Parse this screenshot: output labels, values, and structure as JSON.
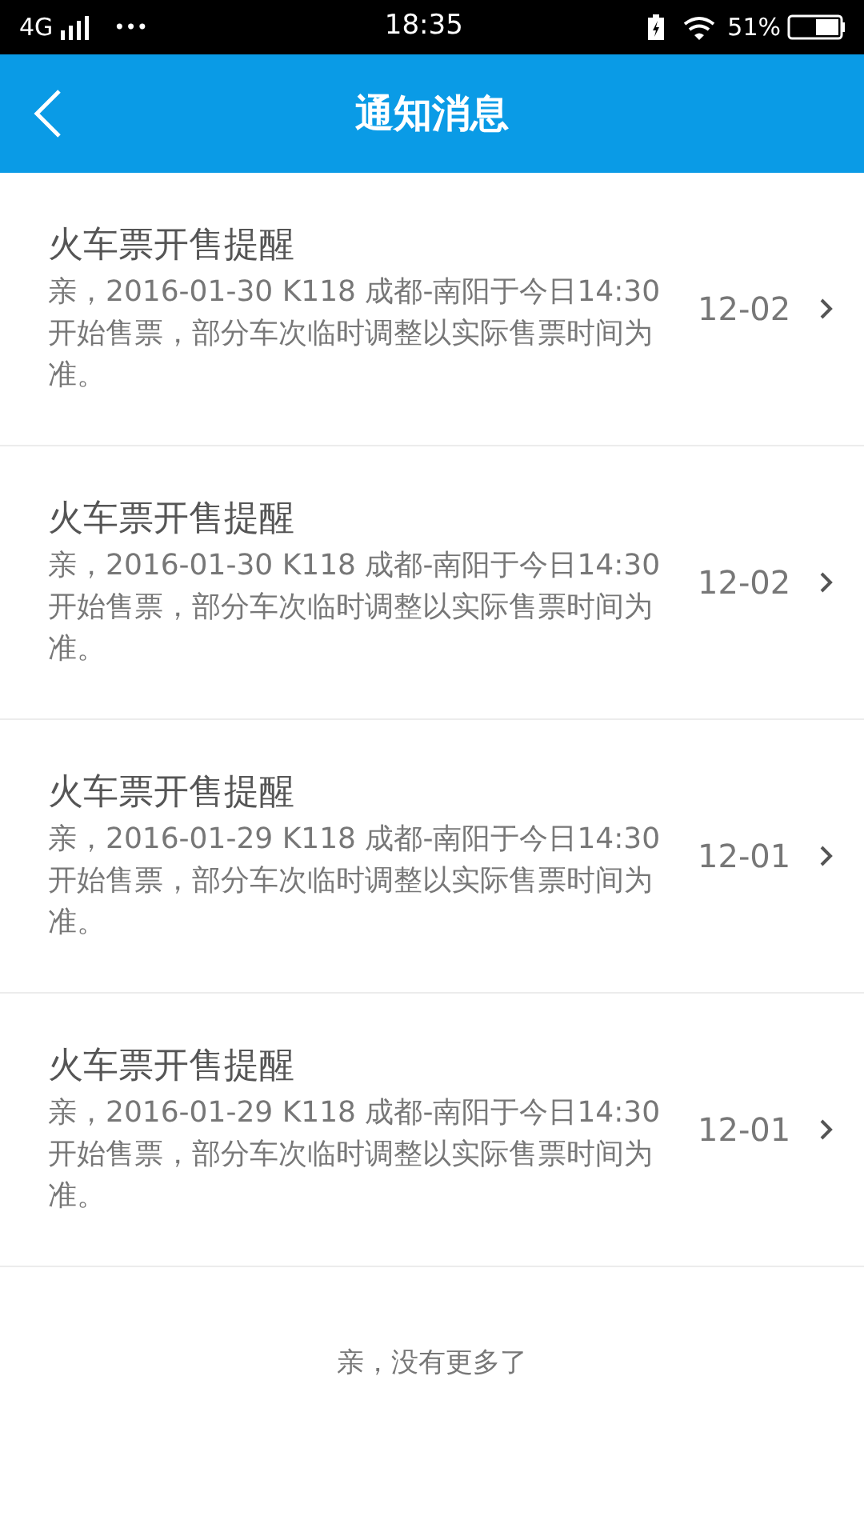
{
  "status_bar": {
    "network": "4G",
    "dots": "•••",
    "time": "18:35",
    "battery": "51%"
  },
  "header": {
    "title": "通知消息"
  },
  "notices": [
    {
      "title": "火车票开售提醒",
      "body": "亲，2016-01-30 K118 成都-南阳于今日14:30开始售票，部分车次临时调整以实际售票时间为准。",
      "date": "12-02"
    },
    {
      "title": "火车票开售提醒",
      "body": "亲，2016-01-30 K118 成都-南阳于今日14:30开始售票，部分车次临时调整以实际售票时间为准。",
      "date": "12-02"
    },
    {
      "title": "火车票开售提醒",
      "body": "亲，2016-01-29 K118 成都-南阳于今日14:30开始售票，部分车次临时调整以实际售票时间为准。",
      "date": "12-01"
    },
    {
      "title": "火车票开售提醒",
      "body": "亲，2016-01-29 K118 成都-南阳于今日14:30开始售票，部分车次临时调整以实际售票时间为准。",
      "date": "12-01"
    }
  ],
  "footer": "亲，没有更多了"
}
